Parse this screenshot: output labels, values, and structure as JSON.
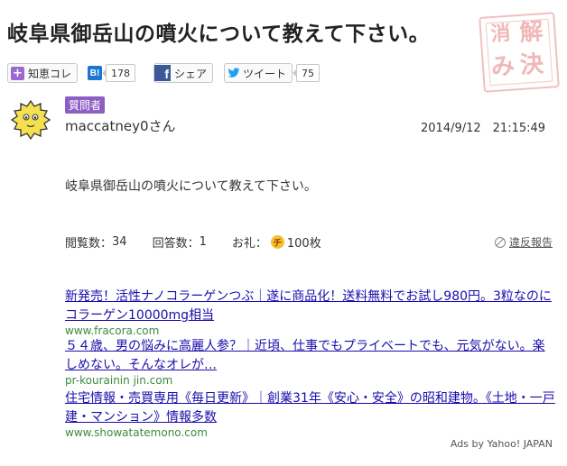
{
  "question_title": "岐阜県御岳山の噴火について教えて下さい。",
  "stamp": {
    "chars": [
      "解",
      "消",
      "決",
      "み"
    ],
    "color": "#f0b8b8"
  },
  "share": {
    "chiebukuro_label": "知恵コレ",
    "hatena_label": "B!",
    "hatena_count": "178",
    "facebook_label": "シェア",
    "twitter_label": "ツイート",
    "twitter_count": "75"
  },
  "question": {
    "role": "質問者",
    "username": "maccatney0",
    "honorific": "さん",
    "posted_at": "2014/9/12　21:15:49",
    "body": "岐阜県御岳山の噴火について教えて下さい。"
  },
  "stats": {
    "views_label": "閲覧数：",
    "views": "34",
    "answers_label": "回答数：",
    "answers": "1",
    "reward_label": "お礼：",
    "coin_glyph": "チ",
    "reward": "100枚",
    "report_label": "違反報告"
  },
  "ads": [
    {
      "title": "新発売！活性ナノコラーゲンつぶ｜遂に商品化！送料無料でお試し980円。3粒なのにコラーゲン10000mg相当",
      "url": "www.fracora.com"
    },
    {
      "title": "５４歳、男の悩みに高麗人参？｜近頃、仕事でもプライベートでも、元気がない。楽しめない。そんなオレが…",
      "url": "pr-kourainin jin.com"
    },
    {
      "title": "住宅情報・売買専用《毎日更新》｜創業31年《安心・安全》の昭和建物。《土地・一戸建・マンション》情報多数",
      "url": "www.showatatemono.com"
    }
  ],
  "ads_by": "Ads by Yahoo! JAPAN",
  "colors": {
    "role_badge": "#8d5fc5",
    "link": "#1a0dab",
    "ad_url": "#3d8a3d"
  }
}
